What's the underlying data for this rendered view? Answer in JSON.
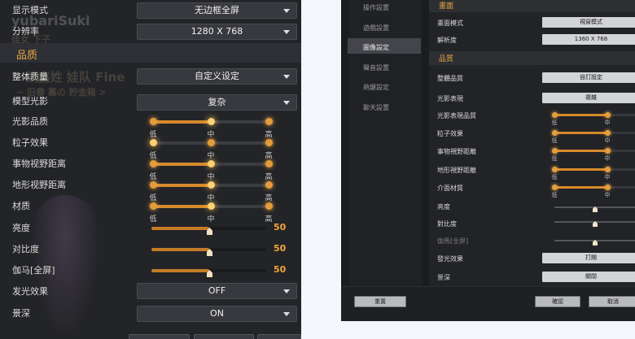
{
  "left": {
    "watermarks": [
      "yubariSuki",
      "佳女 下子",
      "~ 凯鑫姓 娃队 Fine",
      "~ 旧春 裏の 貯金箱 >"
    ],
    "display_mode": {
      "label": "显示模式",
      "value": "无边框全屏"
    },
    "resolution": {
      "label": "分辨率",
      "value": "1280 X 768"
    },
    "quality_section": "品质",
    "overall_quality": {
      "label": "整体质量",
      "value": "自定义设定"
    },
    "model_shading": {
      "label": "模型光影",
      "value": "复杂"
    },
    "tick_labels": [
      "低",
      "中",
      "高"
    ],
    "levels": [
      {
        "label": "光影品质",
        "level": 1
      },
      {
        "label": "粒子效果",
        "level": 0
      },
      {
        "label": "事物视野距离",
        "level": 1
      },
      {
        "label": "地形视野距离",
        "level": 1
      },
      {
        "label": "材质",
        "level": 1
      }
    ],
    "brightness": {
      "label": "亮度",
      "value": "50",
      "fraction": 0.5
    },
    "contrast": {
      "label": "对比度",
      "value": "50",
      "fraction": 0.5
    },
    "gamma": {
      "label": "伽马[全屏]",
      "value": "50",
      "fraction": 0.5
    },
    "glow": {
      "label": "发光效果",
      "value": "OFF"
    },
    "dof": {
      "label": "景深",
      "value": "ON"
    }
  },
  "right": {
    "nav": [
      "操作設置",
      "遊戲設置",
      "圖像設定",
      "聲音設置",
      "熱鍵設定",
      "聊天設置"
    ],
    "nav_selected": 2,
    "screen_section": "畫面",
    "screen_mode": {
      "label": "畫面模式",
      "value": "視窗模式"
    },
    "resolution": {
      "label": "解析度",
      "value": "1360 X 768"
    },
    "quality_section": "品質",
    "overall_quality": {
      "label": "整體品質",
      "value": "自訂設定"
    },
    "shading": {
      "label": "光影表現",
      "value": "複雜"
    },
    "tick_labels": [
      "低",
      "中",
      "高"
    ],
    "levels": [
      {
        "label": "光影表現品質",
        "level": 1
      },
      {
        "label": "粒子效果",
        "level": 1
      },
      {
        "label": "事物視野距離",
        "level": 1
      },
      {
        "label": "地形視野距離",
        "level": 1
      },
      {
        "label": "介面材質",
        "level": 1
      }
    ],
    "brightness": {
      "label": "亮度",
      "fraction": 0.5
    },
    "contrast": {
      "label": "對比度",
      "fraction": 0.5
    },
    "gamma": {
      "label": "伽馬[全屏]",
      "fraction": 0.5
    },
    "glow": {
      "label": "發光效果",
      "value": "打開"
    },
    "dof": {
      "label": "景深",
      "value": "關閉"
    },
    "reset": "重置",
    "ok": "確認",
    "cancel": "取消"
  },
  "colors": {
    "accent": "#e9a847",
    "slider_fill": "#d68a2c",
    "panel_bg": "#232427"
  }
}
